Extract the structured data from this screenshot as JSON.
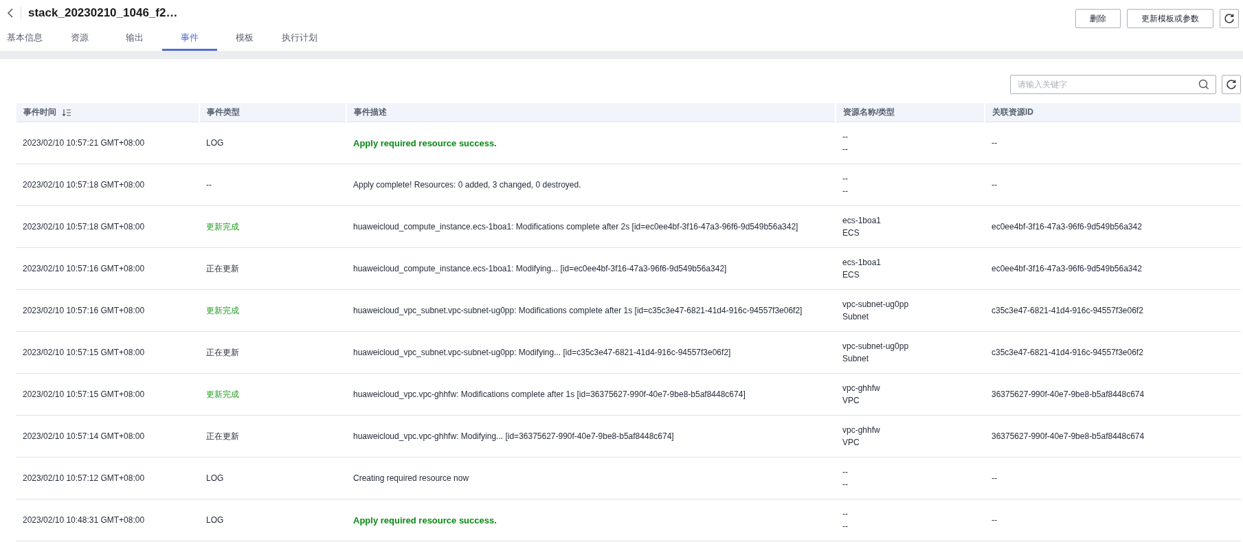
{
  "header": {
    "title": "stack_20230210_1046_f2…",
    "buttons": [
      "删除",
      "更新模板或参数"
    ]
  },
  "tabs": [
    {
      "label": "基本信息",
      "selected": false
    },
    {
      "label": "资源",
      "selected": false
    },
    {
      "label": "输出",
      "selected": false
    },
    {
      "label": "事件",
      "selected": true
    },
    {
      "label": "模板",
      "selected": false
    },
    {
      "label": "执行计划",
      "selected": false
    }
  ],
  "search": {
    "placeholder": "请输入关键字"
  },
  "table": {
    "columns": [
      "事件时间",
      "事件类型",
      "事件描述",
      "资源名称/类型",
      "关联资源ID"
    ],
    "rows": [
      {
        "time": "2023/02/10 10:57:21 GMT+08:00",
        "type": {
          "text": "LOG",
          "kind": "plain"
        },
        "description": {
          "text": "Apply required resource success.",
          "kind": "success"
        },
        "resource_name": "--",
        "resource_type": "--",
        "resource_id": "--"
      },
      {
        "time": "2023/02/10 10:57:18 GMT+08:00",
        "type": {
          "text": "--",
          "kind": "plain"
        },
        "description": {
          "text": "Apply complete! Resources: 0 added, 3 changed, 0 destroyed.",
          "kind": "plain"
        },
        "resource_name": "--",
        "resource_type": "--",
        "resource_id": "--"
      },
      {
        "time": "2023/02/10 10:57:18 GMT+08:00",
        "type": {
          "text": "更新完成",
          "kind": "success"
        },
        "description": {
          "text": "huaweicloud_compute_instance.ecs-1boa1: Modifications complete after 2s [id=ec0ee4bf-3f16-47a3-96f6-9d549b56a342]",
          "kind": "plain"
        },
        "resource_name": "ecs-1boa1",
        "resource_type": "ECS",
        "resource_id": "ec0ee4bf-3f16-47a3-96f6-9d549b56a342"
      },
      {
        "time": "2023/02/10 10:57:16 GMT+08:00",
        "type": {
          "text": "正在更新",
          "kind": "plain"
        },
        "description": {
          "text": "huaweicloud_compute_instance.ecs-1boa1: Modifying... [id=ec0ee4bf-3f16-47a3-96f6-9d549b56a342]",
          "kind": "plain"
        },
        "resource_name": "ecs-1boa1",
        "resource_type": "ECS",
        "resource_id": "ec0ee4bf-3f16-47a3-96f6-9d549b56a342"
      },
      {
        "time": "2023/02/10 10:57:16 GMT+08:00",
        "type": {
          "text": "更新完成",
          "kind": "success"
        },
        "description": {
          "text": "huaweicloud_vpc_subnet.vpc-subnet-ug0pp: Modifications complete after 1s [id=c35c3e47-6821-41d4-916c-94557f3e06f2]",
          "kind": "plain"
        },
        "resource_name": "vpc-subnet-ug0pp",
        "resource_type": "Subnet",
        "resource_id": "c35c3e47-6821-41d4-916c-94557f3e06f2"
      },
      {
        "time": "2023/02/10 10:57:15 GMT+08:00",
        "type": {
          "text": "正在更新",
          "kind": "plain"
        },
        "description": {
          "text": "huaweicloud_vpc_subnet.vpc-subnet-ug0pp: Modifying... [id=c35c3e47-6821-41d4-916c-94557f3e06f2]",
          "kind": "plain"
        },
        "resource_name": "vpc-subnet-ug0pp",
        "resource_type": "Subnet",
        "resource_id": "c35c3e47-6821-41d4-916c-94557f3e06f2"
      },
      {
        "time": "2023/02/10 10:57:15 GMT+08:00",
        "type": {
          "text": "更新完成",
          "kind": "success"
        },
        "description": {
          "text": "huaweicloud_vpc.vpc-ghhfw: Modifications complete after 1s [id=36375627-990f-40e7-9be8-b5af8448c674]",
          "kind": "plain"
        },
        "resource_name": "vpc-ghhfw",
        "resource_type": "VPC",
        "resource_id": "36375627-990f-40e7-9be8-b5af8448c674"
      },
      {
        "time": "2023/02/10 10:57:14 GMT+08:00",
        "type": {
          "text": "正在更新",
          "kind": "plain"
        },
        "description": {
          "text": "huaweicloud_vpc.vpc-ghhfw: Modifying... [id=36375627-990f-40e7-9be8-b5af8448c674]",
          "kind": "plain"
        },
        "resource_name": "vpc-ghhfw",
        "resource_type": "VPC",
        "resource_id": "36375627-990f-40e7-9be8-b5af8448c674"
      },
      {
        "time": "2023/02/10 10:57:12 GMT+08:00",
        "type": {
          "text": "LOG",
          "kind": "plain"
        },
        "description": {
          "text": "Creating required resource now",
          "kind": "plain"
        },
        "resource_name": "--",
        "resource_type": "--",
        "resource_id": "--"
      },
      {
        "time": "2023/02/10 10:48:31 GMT+08:00",
        "type": {
          "text": "LOG",
          "kind": "plain"
        },
        "description": {
          "text": "Apply required resource success.",
          "kind": "success"
        },
        "resource_name": "--",
        "resource_type": "--",
        "resource_id": "--"
      }
    ]
  }
}
